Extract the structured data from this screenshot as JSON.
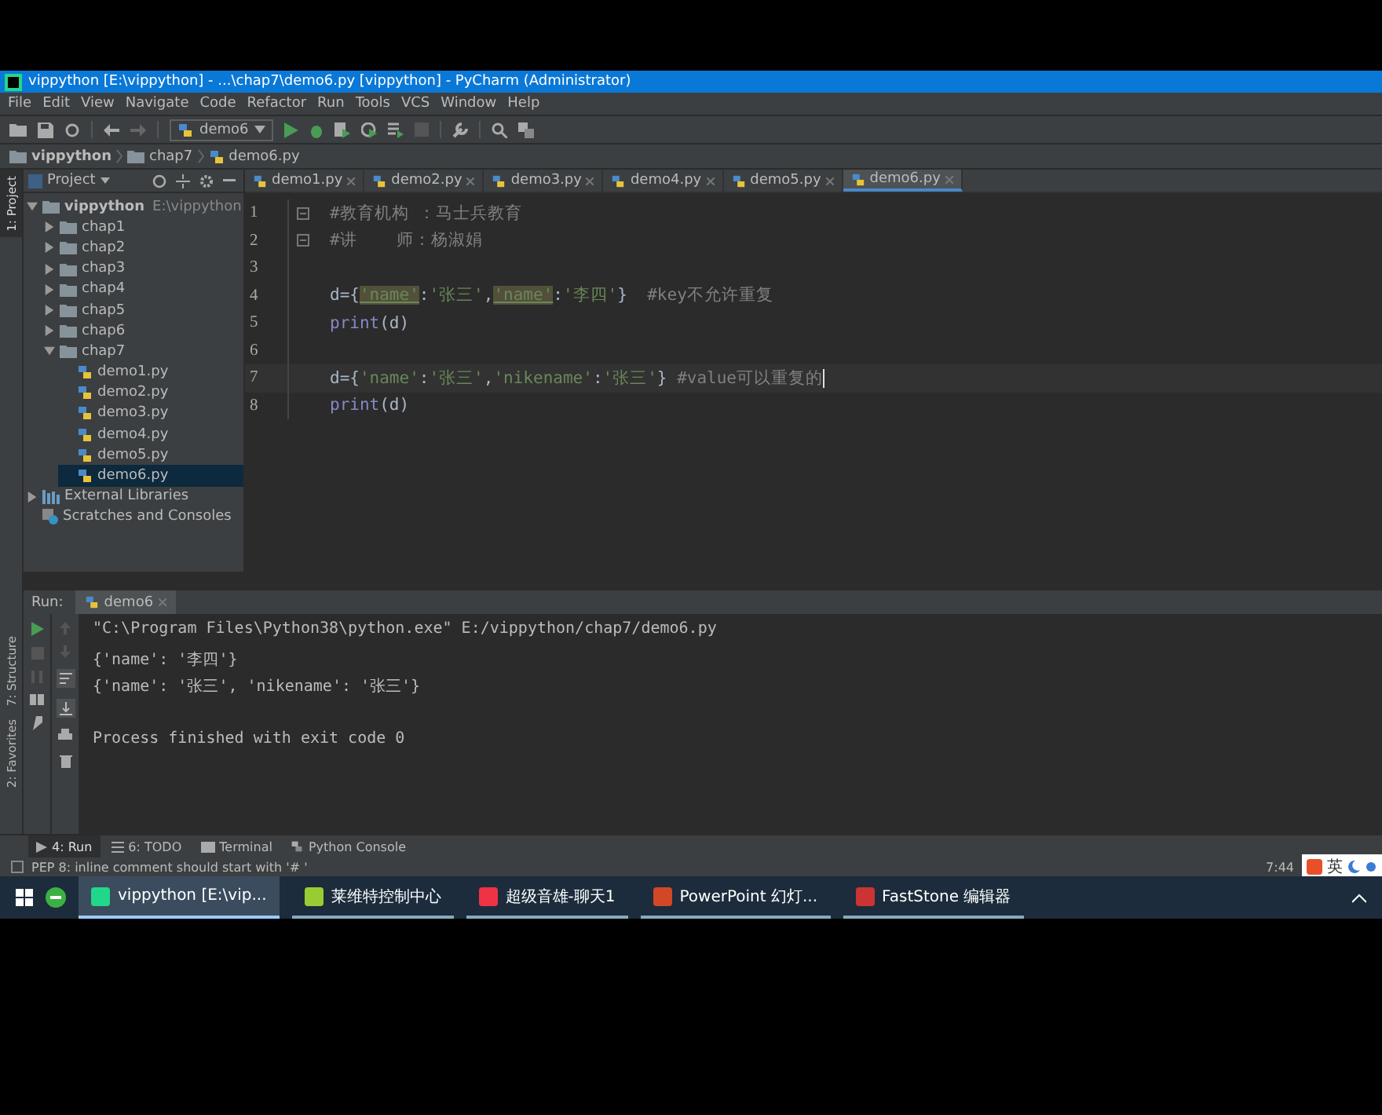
{
  "window": {
    "title": "vippython [E:\\vippython] - ...\\chap7\\demo6.py [vippython] - PyCharm (Administrator)"
  },
  "menu": [
    "File",
    "Edit",
    "View",
    "Navigate",
    "Code",
    "Refactor",
    "Run",
    "Tools",
    "VCS",
    "Window",
    "Help"
  ],
  "toolbar": {
    "run_config": "demo6"
  },
  "breadcrumb": [
    "vippython",
    "chap7",
    "demo6.py"
  ],
  "side_tools": [
    {
      "label": "1: Project",
      "selected": true
    },
    {
      "label": "7: Structure",
      "selected": false
    },
    {
      "label": "2: Favorites",
      "selected": false
    }
  ],
  "project": {
    "title": "Project",
    "tree": [
      {
        "label": "vippython",
        "path": "E:\\vippython",
        "kind": "folder",
        "expanded": true,
        "selected": false,
        "children": [
          {
            "label": "chap1",
            "kind": "folder",
            "expanded": false,
            "selected": false
          },
          {
            "label": "chap2",
            "kind": "folder",
            "expanded": false,
            "selected": false
          },
          {
            "label": "chap3",
            "kind": "folder",
            "expanded": false,
            "selected": false
          },
          {
            "label": "chap4",
            "kind": "folder",
            "expanded": false,
            "selected": false
          },
          {
            "label": "chap5",
            "kind": "folder",
            "expanded": false,
            "selected": false
          },
          {
            "label": "chap6",
            "kind": "folder",
            "expanded": false,
            "selected": false
          },
          {
            "label": "chap7",
            "kind": "folder",
            "expanded": true,
            "selected": false,
            "children": [
              {
                "label": "demo1.py",
                "kind": "file",
                "selected": false
              },
              {
                "label": "demo2.py",
                "kind": "file",
                "selected": false
              },
              {
                "label": "demo3.py",
                "kind": "file",
                "selected": false
              },
              {
                "label": "demo4.py",
                "kind": "file",
                "selected": false
              },
              {
                "label": "demo5.py",
                "kind": "file",
                "selected": false
              },
              {
                "label": "demo6.py",
                "kind": "file",
                "selected": true
              }
            ]
          }
        ]
      },
      {
        "label": "External Libraries",
        "kind": "libraries",
        "expanded": false,
        "selected": false
      },
      {
        "label": "Scratches and Consoles",
        "kind": "scratches",
        "selected": false
      }
    ]
  },
  "tabs": [
    {
      "label": "demo1.py",
      "selected": false
    },
    {
      "label": "demo2.py",
      "selected": false
    },
    {
      "label": "demo3.py",
      "selected": false
    },
    {
      "label": "demo4.py",
      "selected": false
    },
    {
      "label": "demo5.py",
      "selected": false
    },
    {
      "label": "demo6.py",
      "selected": true
    }
  ],
  "editor": {
    "lines": [
      {
        "number": "1",
        "current": false,
        "fold": true,
        "tokens": [
          {
            "kind": "comment",
            "text": "#教育机构 ：马士兵教育"
          }
        ]
      },
      {
        "number": "2",
        "current": false,
        "fold": true,
        "tokens": [
          {
            "kind": "comment",
            "text": "#讲    师：杨淑娟"
          }
        ]
      },
      {
        "number": "3",
        "current": false,
        "fold": false
      },
      {
        "number": "4",
        "current": false,
        "fold": false,
        "tokens": [
          {
            "kind": "plain",
            "text": "d={"
          },
          {
            "kind": "dup",
            "text": "'name'"
          },
          {
            "kind": "plain",
            "text": ":"
          },
          {
            "kind": "string",
            "text": "'张三'"
          },
          {
            "kind": "plain",
            "text": ","
          },
          {
            "kind": "dup",
            "text": "'name'"
          },
          {
            "kind": "plain",
            "text": ":"
          },
          {
            "kind": "string",
            "text": "'李四'"
          },
          {
            "kind": "plain",
            "text": "}  "
          },
          {
            "kind": "comment",
            "text": "#key不允许重复"
          }
        ]
      },
      {
        "number": "5",
        "current": false,
        "fold": false,
        "tokens": [
          {
            "kind": "builtin",
            "text": "print"
          },
          {
            "kind": "plain",
            "text": "(d)"
          }
        ]
      },
      {
        "number": "6",
        "current": false,
        "fold": false
      },
      {
        "number": "7",
        "current": true,
        "fold": false,
        "tokens": [
          {
            "kind": "plain",
            "text": "d={"
          },
          {
            "kind": "string",
            "text": "'name'"
          },
          {
            "kind": "plain",
            "text": ":"
          },
          {
            "kind": "string",
            "text": "'张三'"
          },
          {
            "kind": "plain",
            "text": ","
          },
          {
            "kind": "string",
            "text": "'nikename'"
          },
          {
            "kind": "plain",
            "text": ":"
          },
          {
            "kind": "string",
            "text": "'张三'"
          },
          {
            "kind": "plain",
            "text": "} "
          },
          {
            "kind": "comment",
            "text": "#value可以重复的"
          }
        ]
      },
      {
        "number": "8",
        "current": false,
        "fold": false,
        "tokens": [
          {
            "kind": "builtin",
            "text": "print"
          },
          {
            "kind": "plain",
            "text": "(d)"
          }
        ]
      }
    ]
  },
  "run": {
    "label": "Run:",
    "tab": "demo6",
    "output": [
      "\"C:\\Program Files\\Python38\\python.exe\" E:/vippython/chap7/demo6.py",
      "{'name': '李四'}",
      "{'name': '张三', 'nikename': '张三'}",
      "Process finished with exit code 0"
    ]
  },
  "tool_tabs": [
    {
      "label": "4: Run",
      "kind": "run",
      "selected": true
    },
    {
      "label": "6: TODO",
      "kind": "todo",
      "selected": false
    },
    {
      "label": "Terminal",
      "kind": "terminal",
      "selected": false
    },
    {
      "label": "Python Console",
      "kind": "console",
      "selected": false
    }
  ],
  "status_bar": {
    "message": "PEP 8: inline comment should start with '# '",
    "position": "7:44"
  },
  "taskbar": {
    "items": [
      {
        "label": "vippython [E:\\vip...",
        "kind": "pycharm",
        "selected": true
      },
      {
        "label": "莱维特控制中心",
        "kind": "control",
        "selected": false
      },
      {
        "label": "超级音雄-聊天1",
        "kind": "voice",
        "selected": false
      },
      {
        "label": "PowerPoint 幻灯...",
        "kind": "powerpoint",
        "selected": false
      },
      {
        "label": "FastStone 编辑器",
        "kind": "faststone",
        "selected": false
      }
    ],
    "ime": "英"
  }
}
